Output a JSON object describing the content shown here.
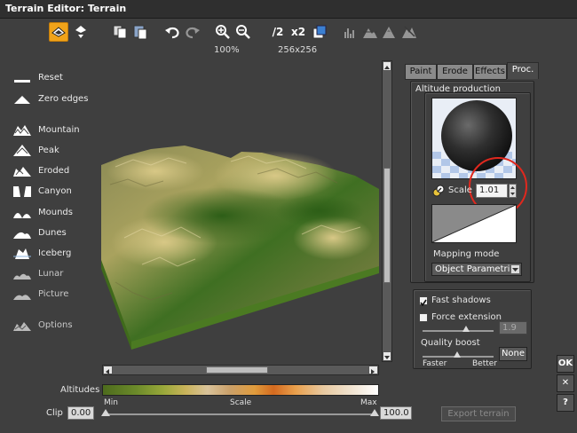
{
  "window": {
    "title": "Terrain Editor: Terrain"
  },
  "toolbar": {
    "zoom_level": "100%",
    "resolution": "256x256",
    "half_label": "/2",
    "double_label": "x2",
    "icons": [
      "terrain-view-icon",
      "dropdown-icon",
      "copy-icon",
      "paste-icon",
      "undo-icon",
      "redo-icon",
      "zoom-in-icon",
      "zoom-out-icon",
      "half-resolution-icon",
      "double-resolution-icon",
      "select-icon",
      "histogram-icon",
      "flatten-icon",
      "filter-icon",
      "erode-icon"
    ]
  },
  "left_panel": {
    "items": [
      {
        "label": "Reset",
        "icon": "reset-icon"
      },
      {
        "label": "Zero edges",
        "icon": "zero-edges-icon"
      },
      {
        "label": "Mountain",
        "icon": "mountain-icon"
      },
      {
        "label": "Peak",
        "icon": "peak-icon"
      },
      {
        "label": "Eroded",
        "icon": "eroded-icon"
      },
      {
        "label": "Canyon",
        "icon": "canyon-icon"
      },
      {
        "label": "Mounds",
        "icon": "mounds-icon"
      },
      {
        "label": "Dunes",
        "icon": "dunes-icon"
      },
      {
        "label": "Iceberg",
        "icon": "iceberg-icon"
      },
      {
        "label": "Lunar",
        "icon": "lunar-icon"
      },
      {
        "label": "Picture",
        "icon": "picture-icon"
      },
      {
        "label": "Options",
        "icon": "options-icon"
      }
    ]
  },
  "bottom": {
    "altitudes_label": "Altitudes",
    "scale_min": "Min",
    "scale_mid": "Scale",
    "scale_max": "Max",
    "clip_label": "Clip",
    "clip_min": "0.00",
    "clip_max": "100.0",
    "export_label": "Export terrain"
  },
  "panel": {
    "tabs": [
      "Paint",
      "Erode",
      "Effects",
      "Proc."
    ],
    "active_tab": "Proc.",
    "section_title": "Altitude production",
    "scale_label": "Scale",
    "scale_value": "1.01",
    "mapping_label": "Mapping mode",
    "mapping_value": "Object Parametric",
    "fast_shadows_label": "Fast shadows",
    "fast_shadows_checked": true,
    "force_extension_label": "Force extension",
    "force_extension_checked": false,
    "force_extension_value": "1.9",
    "quality_boost_label": "Quality boost",
    "faster_label": "Faster",
    "better_label": "Better",
    "none_label": "None"
  },
  "right_buttons": {
    "ok": "OK",
    "cancel": "✕",
    "help": "?"
  },
  "colors": {
    "accent": "#f0a31a",
    "highlight_circle": "#e0281e",
    "background": "#3f3f3f"
  }
}
